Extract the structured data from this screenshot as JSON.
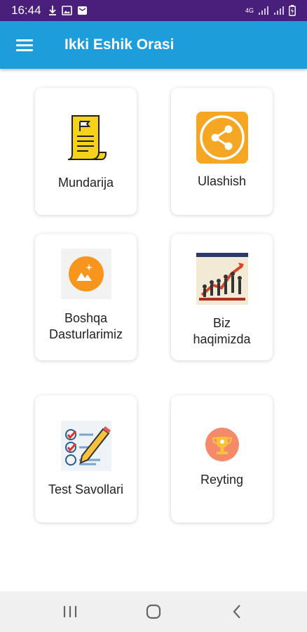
{
  "status_bar": {
    "time": "16:44",
    "network": "4G"
  },
  "app_bar": {
    "title": "Ikki Eshik Orasi",
    "menu_icon": "hamburger-menu-icon"
  },
  "menu": {
    "items": [
      {
        "label": "Mundarija",
        "icon": "document-flag-icon"
      },
      {
        "label": "Ulashish",
        "icon": "share-icon"
      },
      {
        "label": "Boshqa Dasturlarimiz",
        "label_line1": "Boshqa",
        "label_line2": "Dasturlarimiz",
        "icon": "apps-icon"
      },
      {
        "label": "Biz haqimizda",
        "label_line1": "Biz",
        "label_line2": "haqimizda",
        "icon": "team-growth-icon"
      },
      {
        "label": "Test Savollari",
        "icon": "test-checklist-icon"
      },
      {
        "label": "Reyting",
        "icon": "trophy-icon"
      }
    ]
  },
  "colors": {
    "status_bar": "#4a1f7c",
    "app_bar": "#1e9ddb",
    "share_orange": "#f5a623",
    "card_background": "#ffffff"
  },
  "nav_bar": {
    "buttons": [
      "recent-apps-icon",
      "home-icon",
      "back-icon"
    ]
  }
}
